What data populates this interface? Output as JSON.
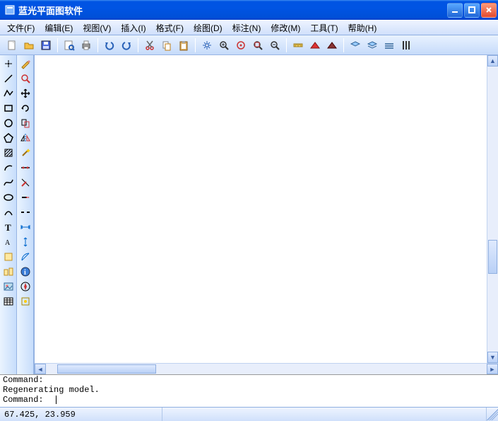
{
  "title": "蓝光平面图软件",
  "menu": [
    {
      "label": "文件(F)"
    },
    {
      "label": "编辑(E)"
    },
    {
      "label": "视图(V)"
    },
    {
      "label": "插入(I)"
    },
    {
      "label": "格式(F)"
    },
    {
      "label": "绘图(D)"
    },
    {
      "label": "标注(N)"
    },
    {
      "label": "修改(M)"
    },
    {
      "label": "工具(T)"
    },
    {
      "label": "帮助(H)"
    }
  ],
  "toolbar_main": [
    "new",
    "open",
    "save",
    "sep",
    "print-preview",
    "print",
    "sep",
    "undo",
    "redo",
    "sep",
    "cut",
    "copy",
    "paste",
    "sep",
    "pan",
    "zoom-in",
    "zoom-extents",
    "zoom-window",
    "zoom-out",
    "sep",
    "measure",
    "dim-red",
    "dim-dark",
    "sep",
    "layer1",
    "layer2",
    "layer3",
    "column"
  ],
  "toolbar_left1": [
    "point",
    "line",
    "polyline",
    "rect",
    "circle",
    "polygon",
    "hatch",
    "arc",
    "spline",
    "ellipse",
    "curve",
    "text-big",
    "text-small",
    "region",
    "block",
    "image",
    "table"
  ],
  "toolbar_left2": [
    "pencil",
    "magnify",
    "move",
    "rotate",
    "copy2",
    "mirror",
    "wand",
    "divide",
    "trim",
    "extend",
    "break",
    "dimension-h",
    "dimension-v",
    "dimension-a",
    "info",
    "compass",
    "snap"
  ],
  "cmd": {
    "line1": "Command:",
    "line2": " Regenerating model.",
    "prompt": "Command:"
  },
  "status": {
    "coords": "  67.425,   23.959"
  }
}
